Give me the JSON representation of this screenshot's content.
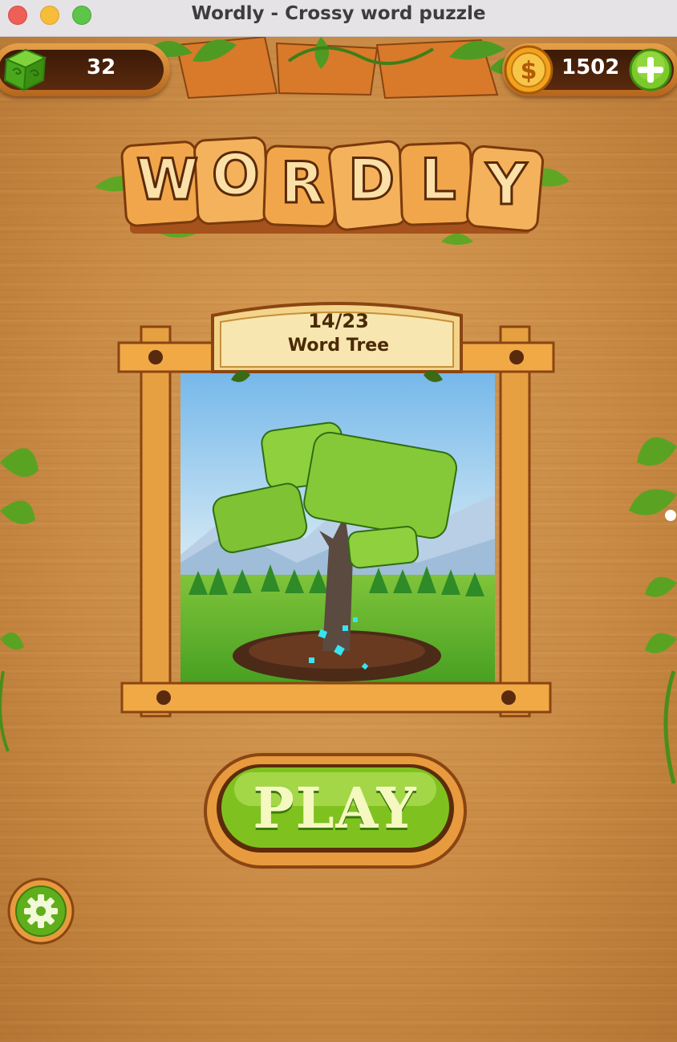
{
  "window": {
    "title": "Wordly - Crossy word puzzle"
  },
  "hud": {
    "cubes_count": "32",
    "coins_count": "1502"
  },
  "logo": {
    "letters": [
      "W",
      "O",
      "R",
      "D",
      "L",
      "Y"
    ]
  },
  "level": {
    "progress": "14/23",
    "name": "Word Tree"
  },
  "play_button": {
    "label": "PLAY"
  },
  "icons": {
    "cube": "green-cube-icon",
    "coin": "dollar-coin-icon",
    "plus": "plus-icon",
    "settings": "gear-icon",
    "leaf": "leaf-icon"
  },
  "colors": {
    "wood": "#c98b45",
    "play_green": "#7fc21f",
    "logo_orange": "#f2a64b",
    "title_text": "#3d3d3d"
  }
}
